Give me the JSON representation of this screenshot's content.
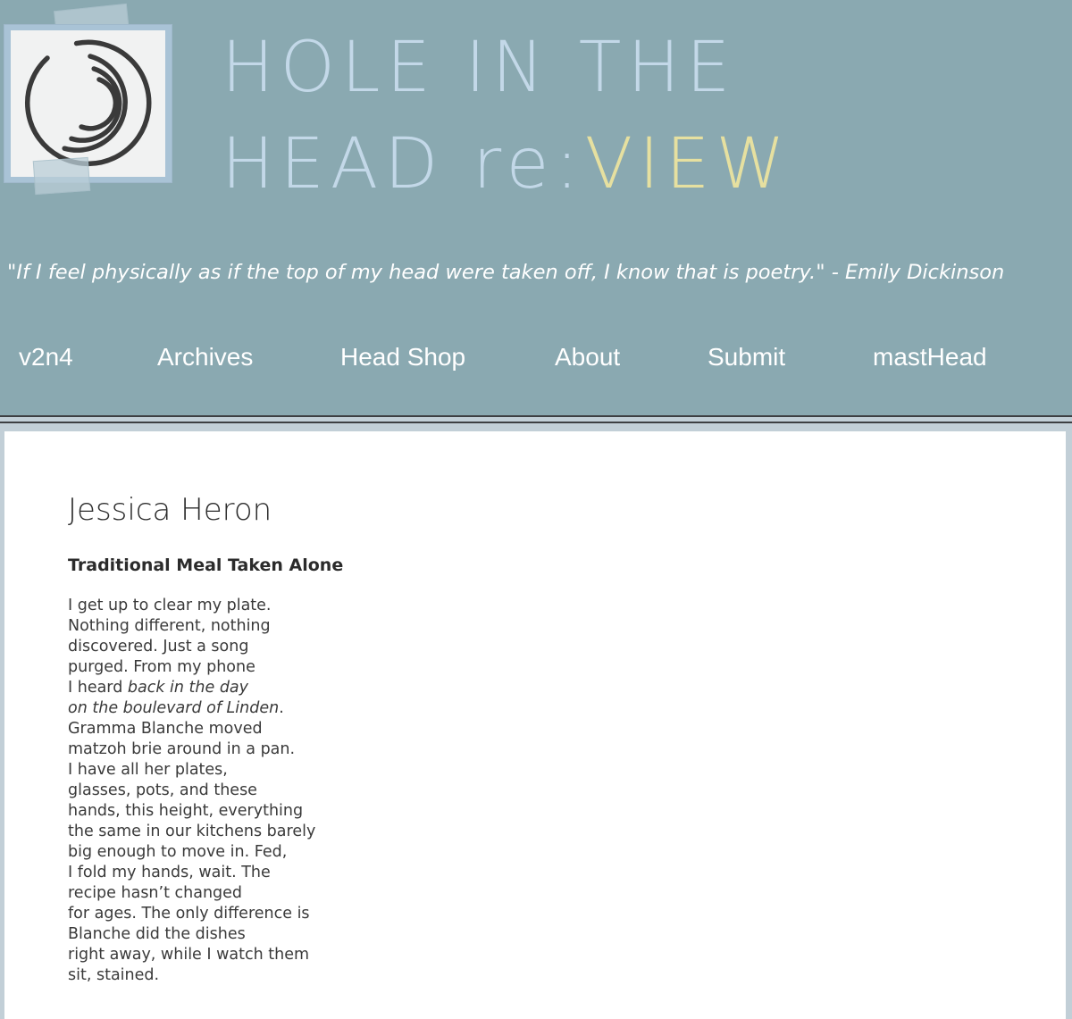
{
  "header": {
    "title_line1": "HOLE IN THE",
    "title_line2_prefix": "HEAD re:",
    "title_line2_accent": "VIEW",
    "quote": "\"If I feel physically as if the top of my head were taken off, I know that is poetry.\" - Emily Dickinson",
    "logo_icon": "concentric-arcs-logo-icon",
    "colors": {
      "header_bg": "#8aa9b1",
      "title": "#c3d8e8",
      "title_accent": "#e6e0a0",
      "nav_text": "#ffffff"
    }
  },
  "nav": {
    "items": [
      {
        "label": "v2n4"
      },
      {
        "label": "Archives"
      },
      {
        "label": "Head Shop"
      },
      {
        "label": "About"
      },
      {
        "label": "Submit"
      },
      {
        "label": "mastHead"
      }
    ]
  },
  "main": {
    "author": "Jessica Heron",
    "poem_title": "Traditional Meal Taken Alone",
    "poem_lines": [
      "I get up to clear my plate.",
      "Nothing different, nothing",
      "discovered. Just a song",
      "purged. From my phone",
      "I heard ",
      "back in the day",
      "on the boulevard of Linden",
      ".",
      "Gramma Blanche moved",
      "matzoh brie around in a pan.",
      "I have all her plates,",
      "glasses, pots, and these",
      "hands, this height, everything",
      "the same in our kitchens barely",
      "big enough to move in. Fed,",
      "I fold my hands, wait. The",
      "recipe hasn’t changed",
      "for ages. The only difference is",
      "Blanche did the dishes",
      "right away, while I watch them",
      "sit, stained."
    ]
  }
}
